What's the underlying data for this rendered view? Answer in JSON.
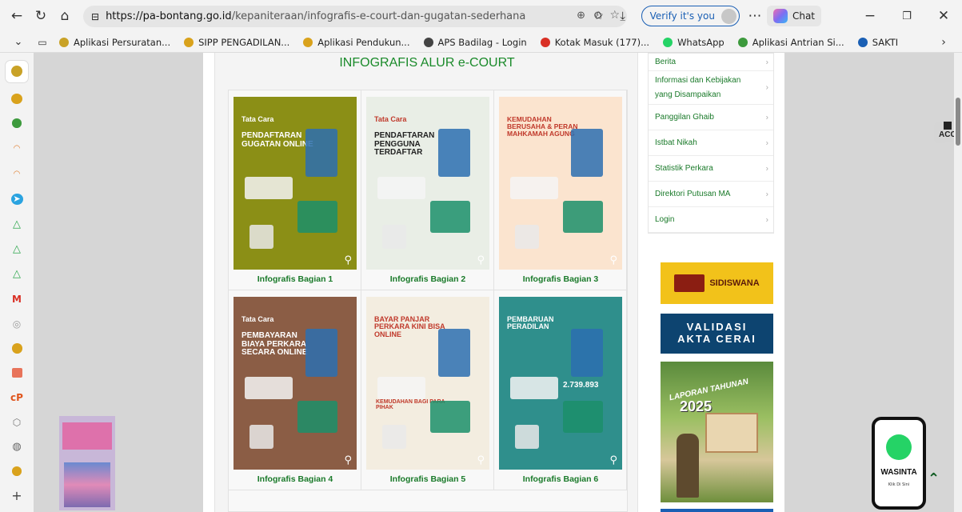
{
  "browser": {
    "url_host": "https://pa-bontang.go.id",
    "url_path": "/kepaniteraan/infografis-e-court-dan-gugatan-sederhana",
    "verify_label": "Verify it's you",
    "chat_label": "Chat"
  },
  "bookmarks": [
    {
      "label": "Aplikasi Persuratan...",
      "color": "#c9a227"
    },
    {
      "label": "SIPP PENGADILAN...",
      "color": "#d9a21c"
    },
    {
      "label": "Aplikasi Pendukun...",
      "color": "#d9a21c"
    },
    {
      "label": "APS Badilag - Login",
      "color": "#444444"
    },
    {
      "label": "Kotak Masuk (177)...",
      "color": "#d93025"
    },
    {
      "label": "WhatsApp",
      "color": "#25d366"
    },
    {
      "label": "Aplikasi Antrian Si...",
      "color": "#3d9a3d"
    },
    {
      "label": "SAKTI",
      "color": "#1a5fb4"
    }
  ],
  "page": {
    "section_title": "INFOGRAFIS ALUR e-COURT",
    "infographics": [
      {
        "caption": "Infografis Bagian 1",
        "bg": "#8b8f16",
        "head1": "Tata Cara",
        "head2": "PENDAFTARAN GUGATAN ONLINE"
      },
      {
        "caption": "Infografis Bagian 2",
        "bg": "#e9eee6",
        "head1": "Tata Cara",
        "head2": "PENDAFTARAN PENGGUNA TERDAFTAR"
      },
      {
        "caption": "Infografis Bagian 3",
        "bg": "#fbe4cf",
        "head1": "KEMUDAHAN BERUSAHA & PERAN MAHKAMAH AGUNG",
        "head2": ""
      },
      {
        "caption": "Infografis Bagian 4",
        "bg": "#8b5d45",
        "head1": "Tata Cara",
        "head2": "PEMBAYARAN BIAYA PERKARA SECARA ONLINE"
      },
      {
        "caption": "Infografis Bagian 5",
        "bg": "#f3ede0",
        "head1": "BAYAR PANJAR PERKARA KINI BISA ONLINE",
        "head2": "KEMUDAHAN BAGI PARA PIHAK"
      },
      {
        "caption": "Infografis Bagian 6",
        "bg": "#2f8f8c",
        "head1": "PEMBARUAN PERADILAN",
        "head2": "2.739.893"
      }
    ],
    "menu": [
      "Berita",
      "Informasi dan Kebijakan yang Disampaikan",
      "Panggilan Ghaib",
      "Istbat Nikah",
      "Statistik Perkara",
      "Direktori Putusan MA",
      "Login"
    ],
    "banners": {
      "sidiswana": "SIDISWANA",
      "validasi": "VALIDASI AKTA CERAI",
      "laporan_title": "LAPORAN TAHUNAN",
      "laporan_year": "2025"
    },
    "whatsapp": {
      "label": "WASINTA",
      "sub": "Klik Di Sini"
    },
    "accessibility": "ACC"
  }
}
